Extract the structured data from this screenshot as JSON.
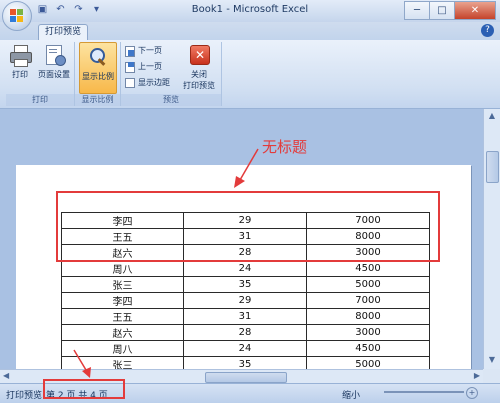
{
  "window": {
    "title": "Book1 - Microsoft Excel",
    "controls": {
      "minimize": "─",
      "maximize": "□",
      "close": "✕"
    }
  },
  "quick_access": [
    {
      "name": "save-icon",
      "glyph": "▣"
    },
    {
      "name": "undo-icon",
      "glyph": "↶"
    },
    {
      "name": "redo-icon",
      "glyph": "↷"
    },
    {
      "name": "qat-dropdown-icon",
      "glyph": "▾"
    }
  ],
  "tabs": [
    {
      "label": "打印预览"
    }
  ],
  "ribbon": {
    "print_group": {
      "label": "打印",
      "print": "打印",
      "page_setup": "页面设置"
    },
    "zoom_group": {
      "label": "显示比例",
      "zoom": "显示比例"
    },
    "preview_group": {
      "label": "预览",
      "next_page": "下一页",
      "prev_page": "上一页",
      "show_margins": "显示边距",
      "close_line1": "关闭",
      "close_line2": "打印预览"
    }
  },
  "annotation": {
    "text": "无标题",
    "color": "#e33b3b"
  },
  "table": {
    "rows": [
      [
        "李四",
        "29",
        "7000"
      ],
      [
        "王五",
        "31",
        "8000"
      ],
      [
        "赵六",
        "28",
        "3000"
      ],
      [
        "周八",
        "24",
        "4500"
      ],
      [
        "张三",
        "35",
        "5000"
      ],
      [
        "李四",
        "29",
        "7000"
      ],
      [
        "王五",
        "31",
        "8000"
      ],
      [
        "赵六",
        "28",
        "3000"
      ],
      [
        "周八",
        "24",
        "4500"
      ],
      [
        "张三",
        "35",
        "5000"
      ]
    ]
  },
  "status": {
    "mode": "打印预览",
    "page_info": "第 2 页  共 4 页",
    "zoom_label": "缩小"
  },
  "colors": {
    "accent": "#e33b3b",
    "ribbon": "#d2e0f2",
    "preview_bg": "#a9c1e3"
  }
}
